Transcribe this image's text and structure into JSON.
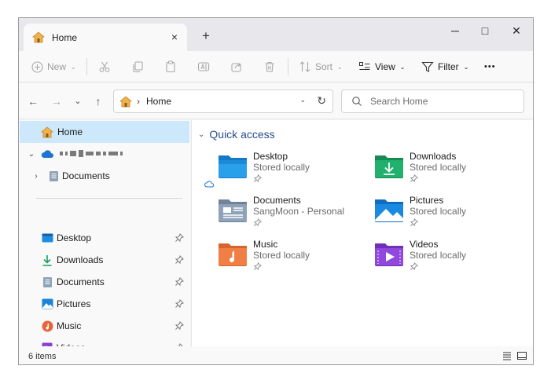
{
  "window": {
    "tab_title": "Home",
    "tab_close": "×",
    "new_tab": "+",
    "controls": {
      "minimize": "─",
      "maximize": "□",
      "close": "✕"
    }
  },
  "toolbar": {
    "new_label": "New",
    "sort_label": "Sort",
    "view_label": "View",
    "filter_label": "Filter",
    "more_label": "•••",
    "chevron": "⌄"
  },
  "navigation": {
    "back": "←",
    "forward": "→",
    "recent": "⌄",
    "up": "↑",
    "breadcrumb_sep": "›",
    "breadcrumb": "Home",
    "refresh": "↻",
    "address_chevron": "⌄",
    "search_placeholder": "Search Home"
  },
  "sidebar": {
    "home": "Home",
    "onedrive_expand": "⌄",
    "documents_expand": "›",
    "documents_group": "Documents",
    "quick_items": [
      {
        "label": "Desktop",
        "icon": "desktop-icon"
      },
      {
        "label": "Downloads",
        "icon": "downloads-icon"
      },
      {
        "label": "Documents",
        "icon": "documents-icon"
      },
      {
        "label": "Pictures",
        "icon": "pictures-icon"
      },
      {
        "label": "Music",
        "icon": "music-icon"
      },
      {
        "label": "Videos",
        "icon": "videos-icon"
      }
    ]
  },
  "main": {
    "section_title": "Quick access",
    "section_chevron": "⌄",
    "folders": [
      {
        "name": "Desktop",
        "subtitle": "Stored locally",
        "icon": "desktop-folder-icon"
      },
      {
        "name": "Downloads",
        "subtitle": "Stored locally",
        "icon": "downloads-folder-icon"
      },
      {
        "name": "Documents",
        "subtitle": "SangMoon - Personal",
        "icon": "documents-folder-icon"
      },
      {
        "name": "Pictures",
        "subtitle": "Stored locally",
        "icon": "pictures-folder-icon"
      },
      {
        "name": "Music",
        "subtitle": "Stored locally",
        "icon": "music-folder-icon"
      },
      {
        "name": "Videos",
        "subtitle": "Stored locally",
        "icon": "videos-folder-icon"
      }
    ]
  },
  "status": {
    "item_count": "6 items"
  },
  "colors": {
    "accent": "#2a4d8f",
    "selection": "#cde8fb",
    "home_icon": "#e8a33d"
  }
}
